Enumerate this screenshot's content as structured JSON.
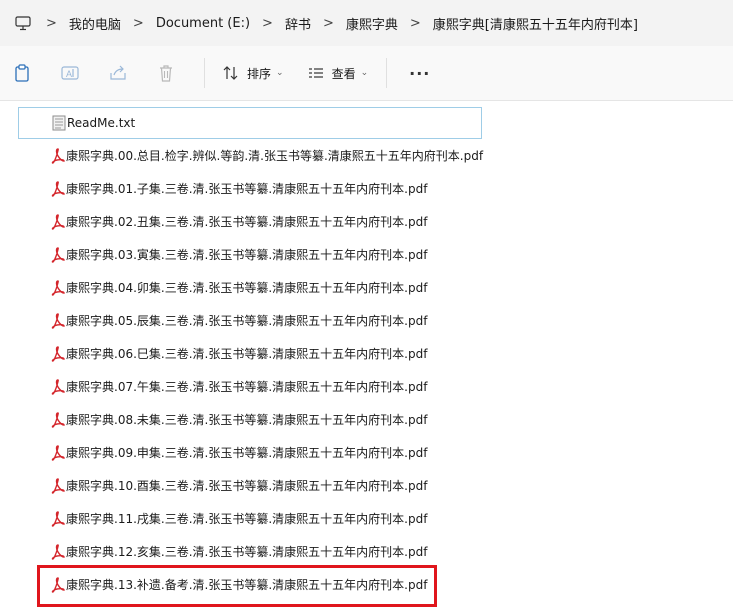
{
  "breadcrumb": {
    "items": [
      "我的电脑",
      "Document (E:)",
      "辞书",
      "康熙字典",
      "康熙字典[清康熙五十五年内府刊本]"
    ],
    "separator": ">"
  },
  "toolbar": {
    "icons": [
      "clipboard-icon",
      "rename-icon",
      "share-icon",
      "delete-icon"
    ],
    "sort_label": "排序",
    "view_label": "查看",
    "more_label": "···"
  },
  "files": [
    {
      "name": "ReadMe.txt",
      "type": "txt"
    },
    {
      "name": "康熙字典.00.总目.检字.辨似.等韵.清.张玉书等纂.清康熙五十五年内府刊本.pdf",
      "type": "pdf"
    },
    {
      "name": "康熙字典.01.子集.三卷.清.张玉书等纂.清康熙五十五年内府刊本.pdf",
      "type": "pdf"
    },
    {
      "name": "康熙字典.02.丑集.三卷.清.张玉书等纂.清康熙五十五年内府刊本.pdf",
      "type": "pdf"
    },
    {
      "name": "康熙字典.03.寅集.三卷.清.张玉书等纂.清康熙五十五年内府刊本.pdf",
      "type": "pdf"
    },
    {
      "name": "康熙字典.04.卯集.三卷.清.张玉书等纂.清康熙五十五年内府刊本.pdf",
      "type": "pdf"
    },
    {
      "name": "康熙字典.05.辰集.三卷.清.张玉书等纂.清康熙五十五年内府刊本.pdf",
      "type": "pdf"
    },
    {
      "name": "康熙字典.06.巳集.三卷.清.张玉书等纂.清康熙五十五年内府刊本.pdf",
      "type": "pdf"
    },
    {
      "name": "康熙字典.07.午集.三卷.清.张玉书等纂.清康熙五十五年内府刊本.pdf",
      "type": "pdf"
    },
    {
      "name": "康熙字典.08.未集.三卷.清.张玉书等纂.清康熙五十五年内府刊本.pdf",
      "type": "pdf"
    },
    {
      "name": "康熙字典.09.申集.三卷.清.张玉书等纂.清康熙五十五年内府刊本.pdf",
      "type": "pdf"
    },
    {
      "name": "康熙字典.10.酉集.三卷.清.张玉书等纂.清康熙五十五年内府刊本.pdf",
      "type": "pdf"
    },
    {
      "name": "康熙字典.11.戌集.三卷.清.张玉书等纂.清康熙五十五年内府刊本.pdf",
      "type": "pdf"
    },
    {
      "name": "康熙字典.12.亥集.三卷.清.张玉书等纂.清康熙五十五年内府刊本.pdf",
      "type": "pdf"
    },
    {
      "name": "康熙字典.13.补遗.备考.清.张玉书等纂.清康熙五十五年内府刊本.pdf",
      "type": "pdf"
    }
  ],
  "colors": {
    "highlight": "#e0161c",
    "pdf_icon": "#d4262c",
    "focus_border": "#9fcde7"
  }
}
